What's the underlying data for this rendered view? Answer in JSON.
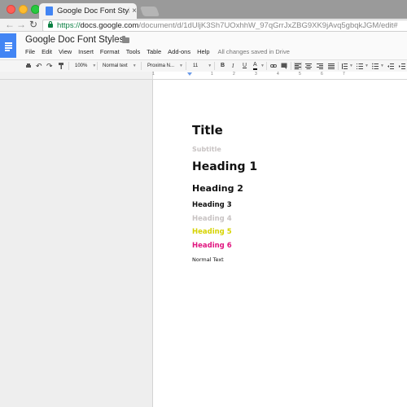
{
  "browser": {
    "tab_title": "Google Doc Font Styles - Goo",
    "tab_close": "×",
    "url_scheme": "https://",
    "url_host": "docs.google.com",
    "url_path": "/document/d/1dUljK3Sh7UOxhhW_97qGrrJxZBG9XK9jAvq5gbqkJGM/edit#"
  },
  "doc": {
    "title": "Google Doc Font Styles",
    "menus": [
      "File",
      "Edit",
      "View",
      "Insert",
      "Format",
      "Tools",
      "Table",
      "Add-ons",
      "Help"
    ],
    "save_status": "All changes saved in Drive"
  },
  "toolbar": {
    "zoom": "100%",
    "style": "Normal text",
    "font": "Proxima N...",
    "font_size": "11",
    "bold": "B",
    "italic": "I",
    "underline": "U",
    "text_color": "A"
  },
  "ruler": {
    "numbers": [
      "1",
      "1",
      "2",
      "3",
      "4",
      "5",
      "6",
      "7"
    ]
  },
  "content": {
    "title": "Title",
    "subtitle": "Subtitle",
    "h1": "Heading 1",
    "h2": "Heading 2",
    "h3": "Heading 3",
    "h4": "Heading 4",
    "h5": "Heading 5",
    "h6": "Heading 6",
    "normal": "Normal Text"
  },
  "colors": {
    "docs_blue": "#4285f4",
    "subtle_gray": "#c8c3c3",
    "heading5_yellow": "#d6d300",
    "heading6_magenta": "#e0157f"
  }
}
